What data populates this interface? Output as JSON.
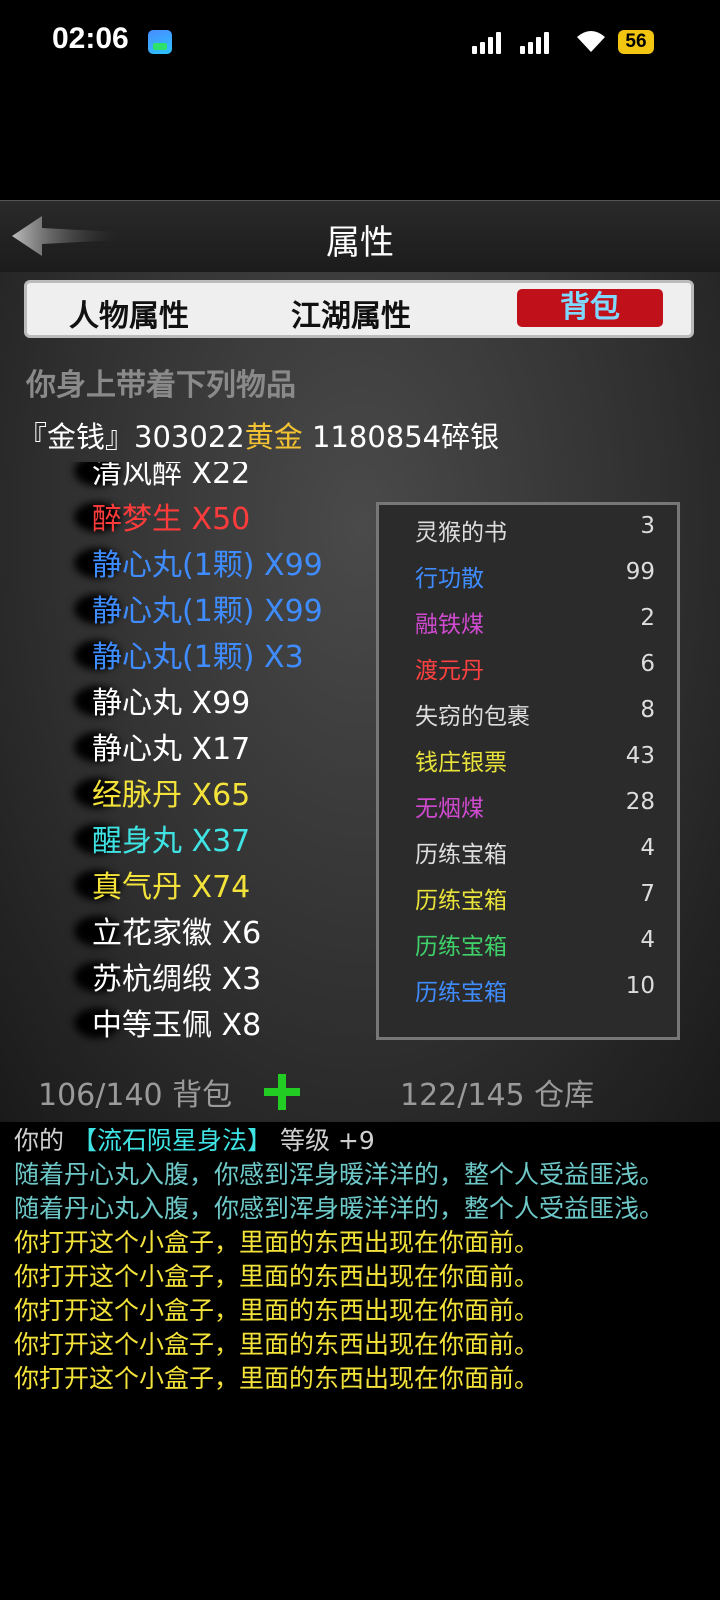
{
  "status": {
    "time": "02:06",
    "battery": "56"
  },
  "header": {
    "title": "属性"
  },
  "tabs": [
    {
      "label": "人物属性"
    },
    {
      "label": "江湖属性"
    },
    {
      "label": "背包"
    }
  ],
  "bag": {
    "carry_label": "你身上带着下列物品",
    "money_prefix": "『金钱』",
    "gold_amount": "303022",
    "gold_unit": "黄金",
    "silver_amount": "1180854",
    "silver_unit": "碎银",
    "items": [
      {
        "text": "清风醉 X22",
        "color": "#ffffff"
      },
      {
        "text": "醉梦生 X50",
        "color": "#ff3b3b"
      },
      {
        "text": "静心丸(1颗) X99",
        "color": "#3f8cff"
      },
      {
        "text": "静心丸(1颗) X99",
        "color": "#3f8cff"
      },
      {
        "text": "静心丸(1颗) X3",
        "color": "#3f8cff"
      },
      {
        "text": "静心丸 X99",
        "color": "#ffffff"
      },
      {
        "text": "静心丸 X17",
        "color": "#ffffff"
      },
      {
        "text": "经脉丹 X65",
        "color": "#f3e23a"
      },
      {
        "text": "醒身丸 X37",
        "color": "#3fe3e3"
      },
      {
        "text": "真气丹 X74",
        "color": "#f3e23a"
      },
      {
        "text": "立花家徽 X6",
        "color": "#ffffff"
      },
      {
        "text": "苏杭绸缎 X3",
        "color": "#ffffff"
      },
      {
        "text": "中等玉佩 X8",
        "color": "#ffffff"
      }
    ],
    "bag_count": "106/140 背包",
    "warehouse_count": "122/145 仓库"
  },
  "storage": [
    {
      "name": "灵猴的书",
      "count": "3",
      "color": "#dddddd"
    },
    {
      "name": "行功散",
      "count": "99",
      "color": "#3f8cff"
    },
    {
      "name": "融铁煤",
      "count": "2",
      "color": "#d04ad0"
    },
    {
      "name": "渡元丹",
      "count": "6",
      "color": "#ff4040"
    },
    {
      "name": "失窃的包裹",
      "count": "8",
      "color": "#dddddd"
    },
    {
      "name": "钱庄银票",
      "count": "43",
      "color": "#e8e23a"
    },
    {
      "name": "无烟煤",
      "count": "28",
      "color": "#d04ad0"
    },
    {
      "name": "历练宝箱",
      "count": "4",
      "color": "#dddddd"
    },
    {
      "name": "历练宝箱",
      "count": "7",
      "color": "#e8e23a"
    },
    {
      "name": "历练宝箱",
      "count": "4",
      "color": "#3fd06a"
    },
    {
      "name": "历练宝箱",
      "count": "10",
      "color": "#3f8cff"
    }
  ],
  "log": {
    "skill_prefix": "你的",
    "skill_name": "【流石陨星身法】",
    "skill_suffix": "等级 +9",
    "lines": [
      {
        "text": "随着丹心丸入腹，你感到浑身暖洋洋的，整个人受益匪浅。",
        "cls": "c-teal"
      },
      {
        "text": "随着丹心丸入腹，你感到浑身暖洋洋的，整个人受益匪浅。",
        "cls": "c-teal"
      },
      {
        "text": "你打开这个小盒子，里面的东西出现在你面前。",
        "cls": "c-yellow"
      },
      {
        "text": "你打开这个小盒子，里面的东西出现在你面前。",
        "cls": "c-yellow"
      },
      {
        "text": "你打开这个小盒子，里面的东西出现在你面前。",
        "cls": "c-yellow"
      },
      {
        "text": "你打开这个小盒子，里面的东西出现在你面前。",
        "cls": "c-yellow"
      },
      {
        "text": "你打开这个小盒子，里面的东西出现在你面前。",
        "cls": "c-yellow"
      }
    ]
  }
}
